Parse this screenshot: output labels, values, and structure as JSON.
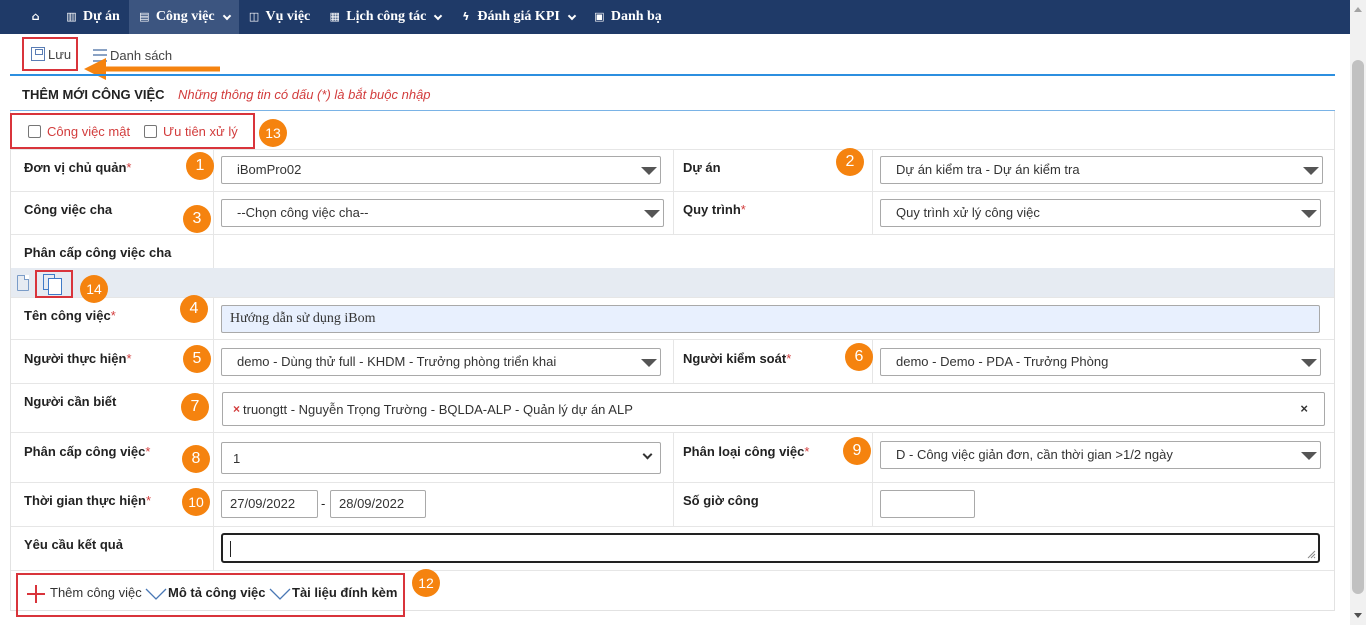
{
  "nav": {
    "items": [
      {
        "label": "",
        "icon": "home-icon"
      },
      {
        "label": "Dự án",
        "icon": "chart-icon"
      },
      {
        "label": "Công việc",
        "icon": "clipboard-icon",
        "has_dropdown": true,
        "active": true
      },
      {
        "label": "Vụ việc",
        "icon": "book-icon"
      },
      {
        "label": "Lịch công tác",
        "icon": "calendar-icon",
        "has_dropdown": true
      },
      {
        "label": "Đánh giá KPI",
        "icon": "bolt-icon",
        "has_dropdown": true
      },
      {
        "label": "Danh bạ",
        "icon": "contact-icon"
      }
    ]
  },
  "toolbar": {
    "save_label": "Lưu",
    "list_label": "Danh sách"
  },
  "form": {
    "title": "THÊM MỚI CÔNG VIỆC",
    "note": "Những thông tin có dấu (*) là bắt buộc nhập",
    "confidential_label": "Công việc mật",
    "priority_label": "Ưu tiên xử lý",
    "unit_label": "Đơn vị chủ quản",
    "unit_value": "iBomPro02",
    "project_label": "Dự án",
    "project_value": "Dự án kiểm tra - Dự án kiểm tra",
    "parent_label": "Công việc cha",
    "parent_value": "--Chọn công việc cha--",
    "process_label": "Quy trình",
    "process_value": "Quy trình xử lý công việc",
    "parent_level_label": "Phân cấp công việc cha",
    "name_label": "Tên công việc",
    "name_value": "Hướng dẫn sử dụng iBom",
    "assignee_label": "Người thực hiện",
    "assignee_value": "demo - Dùng thử full - KHDM - Trưởng phòng triển khai",
    "controller_label": "Người kiểm soát",
    "controller_value": "demo - Demo - PDA - Trưởng Phòng",
    "watchers_label": "Người cần biết",
    "watcher_tag": "truongtt - Nguyễn Trọng Trường - BQLDA-ALP - Quản lý dự án ALP",
    "level_label": "Phân cấp công việc",
    "level_value": "1",
    "type_label": "Phân loại công việc",
    "type_value": "D - Công việc giản đơn, cần thời gian >1/2 ngày",
    "time_label": "Thời gian thực hiện",
    "start_date": "27/09/2022",
    "date_sep": "-",
    "end_date": "28/09/2022",
    "hours_label": "Số giờ công",
    "result_label": "Yêu cầu kết quả",
    "required_mark": "*"
  },
  "bottom": {
    "add_label": "Thêm công việc",
    "desc_label": "Mô tả công việc",
    "attach_label": "Tài liệu đính kèm"
  },
  "badges": [
    "1",
    "2",
    "3",
    "4",
    "5",
    "6",
    "7",
    "8",
    "9",
    "10",
    "12",
    "13",
    "14"
  ],
  "colors": {
    "nav_bg": "#1f3a68",
    "accent_red": "#d9343b",
    "badge_orange": "#f5830f",
    "blue_line": "#2c8fe0"
  }
}
